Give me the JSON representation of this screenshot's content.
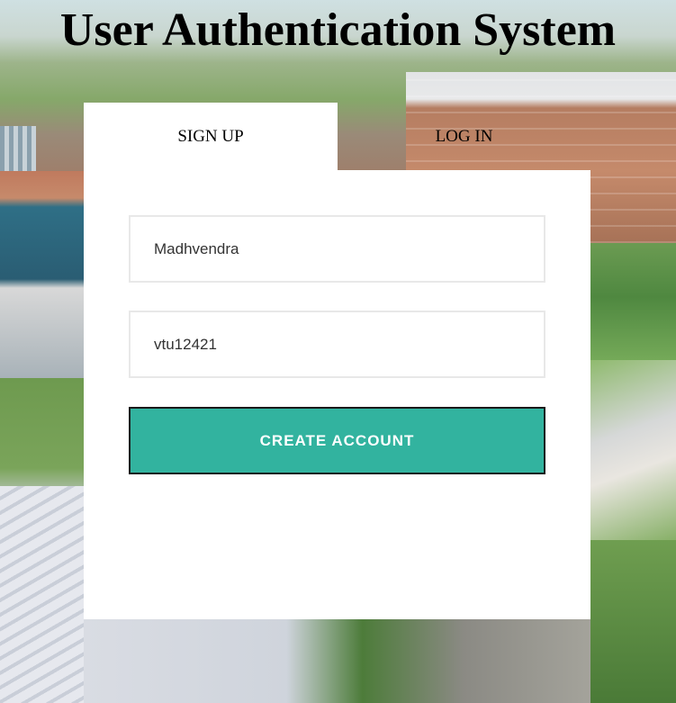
{
  "header": {
    "title": "User Authentication System"
  },
  "tabs": [
    {
      "label": "SIGN UP",
      "active": true
    },
    {
      "label": "LOG IN",
      "active": false
    }
  ],
  "form": {
    "username": {
      "value": "Madhvendra"
    },
    "password": {
      "value": "vtu12421"
    },
    "submit_label": "CREATE ACCOUNT"
  },
  "colors": {
    "accent": "#32b39f",
    "panel": "#ffffff",
    "field_border": "#e8e8e8"
  }
}
